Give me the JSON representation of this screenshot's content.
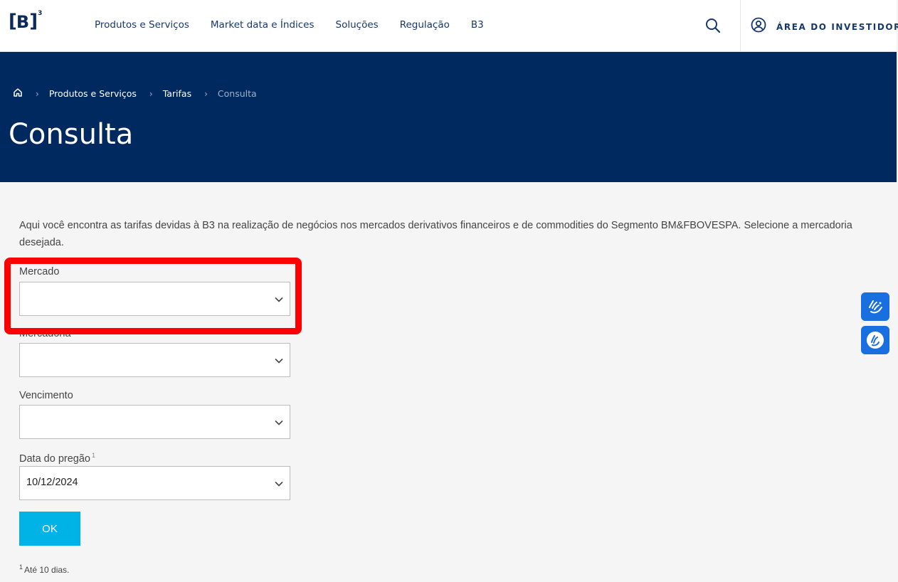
{
  "header": {
    "logo": {
      "letter": "B",
      "superscript": "3",
      "icon": "b3-logo"
    },
    "nav": [
      "Produtos e Serviços",
      "Market data e Índices",
      "Soluções",
      "Regulação",
      "B3"
    ],
    "search_icon": "search-icon",
    "investor_label": "ÁREA DO INVESTIDOR",
    "investor_icon": "user-circle-icon"
  },
  "hero": {
    "breadcrumb": {
      "home_icon": "home-icon",
      "items": [
        "Produtos e Serviços",
        "Tarifas",
        "Consulta"
      ]
    },
    "title": "Consulta",
    "background": "#002a5f"
  },
  "main": {
    "intro": "Aqui você encontra as tarifas devidas à B3 na realização de negócios nos mercados derivativos financeiros e de commodities do Segmento BM&FBOVESPA. Selecione a mercadoria desejada.",
    "fields": [
      {
        "label": "Mercado",
        "value": ""
      },
      {
        "label": "Mercadoria",
        "value": ""
      },
      {
        "label": "Vencimento",
        "value": ""
      },
      {
        "label": "Data do pregão",
        "footnote_mark": "1",
        "value": "10/12/2024"
      }
    ],
    "submit_label": "OK",
    "footnote": {
      "mark": "1",
      "text": "Até 10 dias."
    }
  },
  "accessibility": [
    "sign-language-icon",
    "accessibility-hand-icon"
  ],
  "colors": {
    "navy": "#002a5f",
    "button": "#00b3e6",
    "highlight": "#ff0000",
    "widget": "#1a6fe0"
  }
}
